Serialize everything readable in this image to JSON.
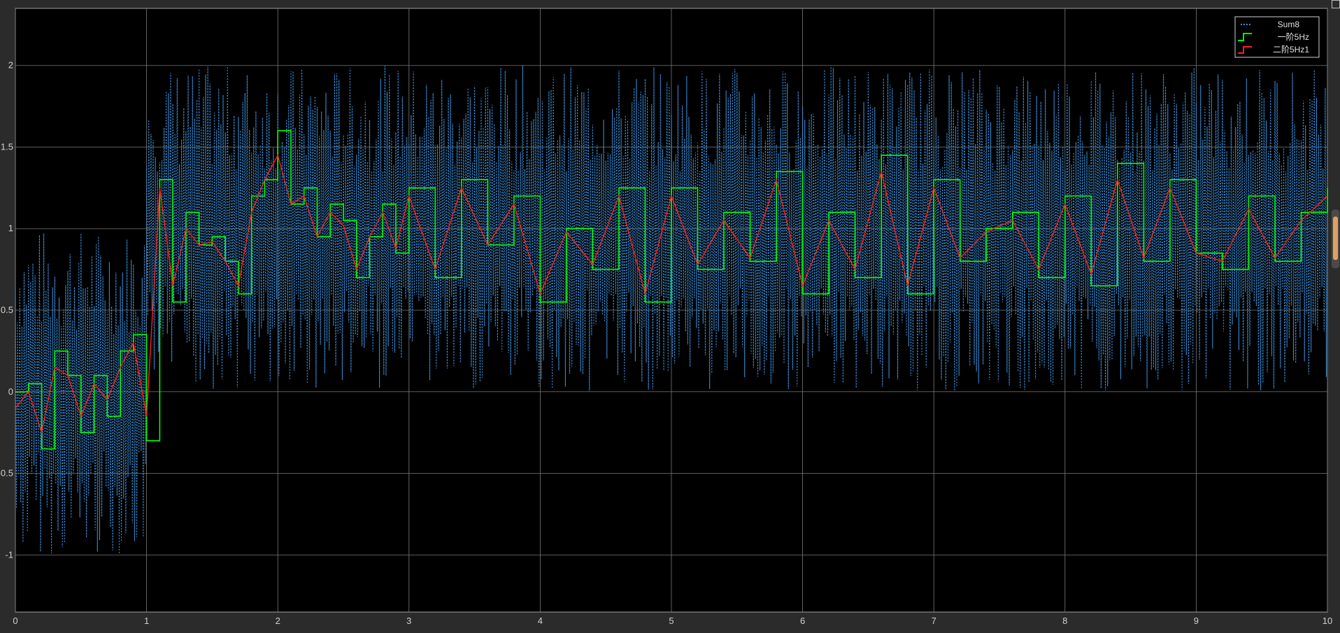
{
  "colors": {
    "background": "#000000",
    "frame": "#2b2b2b",
    "grid": "#7a7a7a",
    "axis_text": "#d0d0d0",
    "sum8": "#3a8fd8",
    "first_order": "#00ff00",
    "second_order": "#ff2020"
  },
  "chart_data": {
    "type": "line",
    "title": "",
    "xlabel": "",
    "ylabel": "",
    "xlim": [
      0,
      10
    ],
    "ylim": [
      -1.35,
      2.35
    ],
    "x_ticks": [
      0,
      1,
      2,
      3,
      4,
      5,
      6,
      7,
      8,
      9,
      10
    ],
    "x_tick_labels": [
      "0",
      "1",
      "2",
      "3",
      "4",
      "5",
      "6",
      "7",
      "8",
      "9",
      "10"
    ],
    "y_ticks": [
      -1,
      -0.5,
      0,
      0.5,
      1,
      1.5,
      2
    ],
    "y_tick_labels": [
      "-1",
      "-0.5",
      "0",
      "0.5",
      "1",
      "1.5",
      "2"
    ],
    "grid": true,
    "legend_position": "top-right",
    "series": [
      {
        "name": "Sum8",
        "color": "#3a8fd8",
        "style": "dotted",
        "description_values": {
          "segment_1": {
            "x_range": [
              0,
              1
            ],
            "mean": 0.0,
            "range": [
              -1.0,
              1.0
            ]
          },
          "segment_2": {
            "x_range": [
              1,
              10
            ],
            "mean": 1.0,
            "range": [
              0.0,
              2.0
            ]
          }
        }
      },
      {
        "name": "一阶5Hz",
        "color": "#00ff00",
        "style": "step",
        "x": [
          0,
          0.1,
          0.2,
          0.3,
          0.4,
          0.5,
          0.6,
          0.7,
          0.8,
          0.9,
          1.0,
          1.1,
          1.2,
          1.3,
          1.4,
          1.5,
          1.6,
          1.7,
          1.8,
          1.9,
          2.0,
          2.1,
          2.2,
          2.3,
          2.4,
          2.5,
          2.6,
          2.7,
          2.8,
          2.9,
          3.0,
          3.2,
          3.4,
          3.6,
          3.8,
          4.0,
          4.2,
          4.4,
          4.6,
          4.8,
          5.0,
          5.2,
          5.4,
          5.6,
          5.8,
          6.0,
          6.2,
          6.4,
          6.6,
          6.8,
          7.0,
          7.2,
          7.4,
          7.6,
          7.8,
          8.0,
          8.2,
          8.4,
          8.6,
          8.8,
          9.0,
          9.2,
          9.4,
          9.6,
          9.8,
          10.0
        ],
        "y": [
          0.0,
          0.05,
          -0.35,
          0.25,
          0.1,
          -0.25,
          0.1,
          -0.15,
          0.25,
          0.35,
          -0.3,
          1.3,
          0.55,
          1.1,
          0.9,
          0.95,
          0.8,
          0.6,
          1.2,
          1.3,
          1.6,
          1.15,
          1.25,
          0.95,
          1.15,
          1.05,
          0.7,
          0.95,
          1.15,
          0.85,
          1.25,
          0.7,
          1.3,
          0.9,
          1.2,
          0.55,
          1.0,
          0.75,
          1.25,
          0.55,
          1.25,
          0.75,
          1.1,
          0.8,
          1.35,
          0.6,
          1.1,
          0.7,
          1.45,
          0.6,
          1.3,
          0.8,
          1.0,
          1.1,
          0.7,
          1.2,
          0.65,
          1.4,
          0.8,
          1.3,
          0.85,
          0.75,
          1.2,
          0.8,
          1.1,
          1.25
        ]
      },
      {
        "name": "二阶5Hz1",
        "color": "#ff2020",
        "style": "line",
        "x": [
          0,
          0.1,
          0.2,
          0.3,
          0.4,
          0.5,
          0.6,
          0.7,
          0.8,
          0.9,
          1.0,
          1.1,
          1.2,
          1.3,
          1.4,
          1.5,
          1.6,
          1.7,
          1.8,
          1.9,
          2.0,
          2.1,
          2.2,
          2.3,
          2.4,
          2.5,
          2.6,
          2.7,
          2.8,
          2.9,
          3.0,
          3.2,
          3.4,
          3.6,
          3.8,
          4.0,
          4.2,
          4.4,
          4.6,
          4.8,
          5.0,
          5.2,
          5.4,
          5.6,
          5.8,
          6.0,
          6.2,
          6.4,
          6.6,
          6.8,
          7.0,
          7.2,
          7.4,
          7.6,
          7.8,
          8.0,
          8.2,
          8.4,
          8.6,
          8.8,
          9.0,
          9.2,
          9.4,
          9.6,
          9.8,
          10.0
        ],
        "y": [
          -0.1,
          0.0,
          -0.25,
          0.15,
          0.1,
          -0.15,
          0.05,
          -0.05,
          0.15,
          0.3,
          -0.15,
          1.25,
          0.65,
          1.0,
          0.9,
          0.92,
          0.8,
          0.65,
          1.1,
          1.3,
          1.45,
          1.15,
          1.2,
          0.95,
          1.1,
          1.02,
          0.75,
          0.95,
          1.1,
          0.88,
          1.2,
          0.75,
          1.25,
          0.9,
          1.15,
          0.6,
          0.98,
          0.78,
          1.2,
          0.6,
          1.2,
          0.78,
          1.05,
          0.82,
          1.3,
          0.65,
          1.05,
          0.75,
          1.35,
          0.65,
          1.25,
          0.82,
          0.98,
          1.05,
          0.75,
          1.15,
          0.72,
          1.3,
          0.82,
          1.25,
          0.85,
          0.8,
          1.12,
          0.82,
          1.05,
          1.2
        ]
      }
    ]
  }
}
